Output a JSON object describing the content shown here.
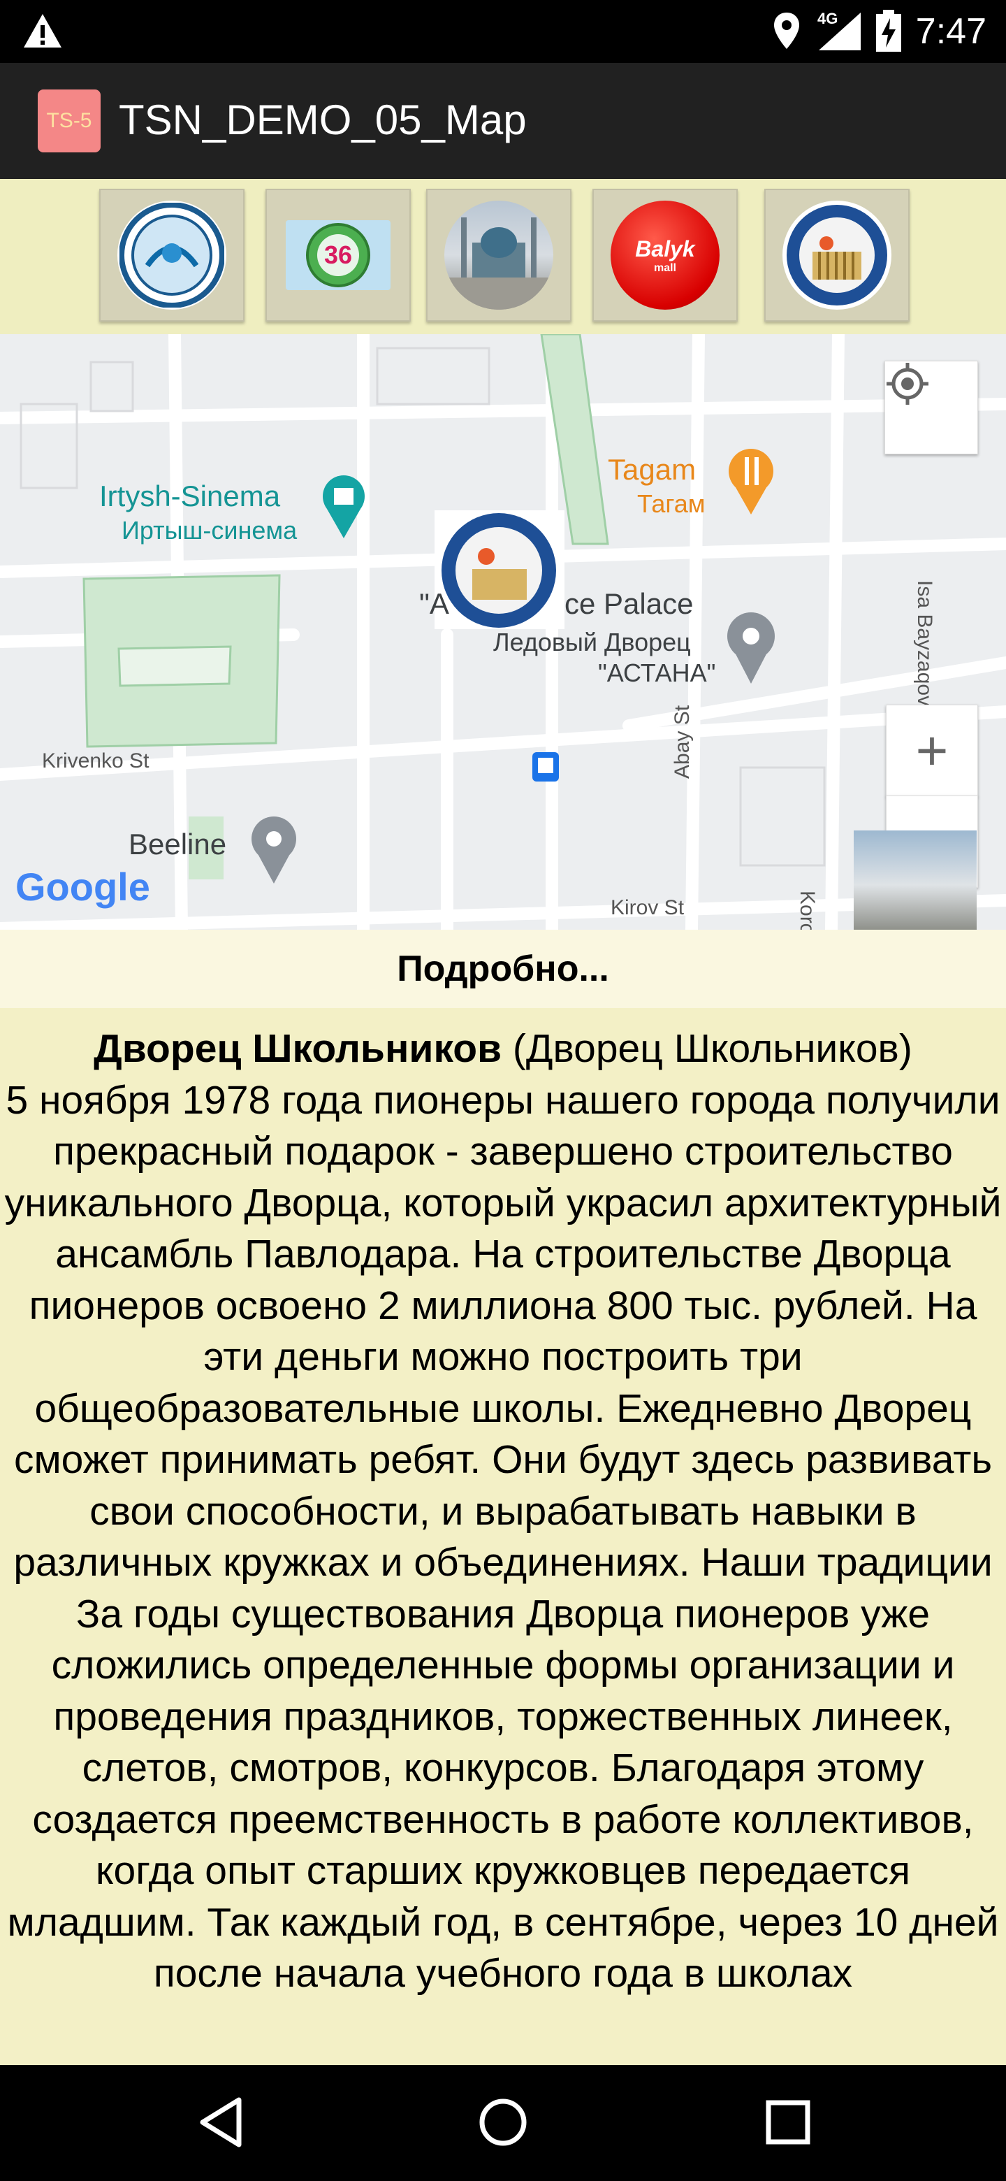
{
  "status_bar": {
    "time": "7:47",
    "network": "4G",
    "icons": [
      "warning-icon",
      "location-icon",
      "signal-icon",
      "battery-icon"
    ]
  },
  "app_bar": {
    "logo_text": "TS-5",
    "title": "TSN_DEMO_05_Map"
  },
  "icon_strip": {
    "items": [
      {
        "name": "emblem-round"
      },
      {
        "name": "emblem-36",
        "text": "36"
      },
      {
        "name": "mosque-photo"
      },
      {
        "name": "balyk-logo",
        "text": "Balyk",
        "subtext": "mall"
      },
      {
        "name": "palace-emblem"
      }
    ]
  },
  "map": {
    "places": {
      "irtysh_en": "Irtysh-Sinema",
      "irtysh_ru": "Иртыш-синема",
      "tagam_en": "Tagam",
      "tagam_ru": "Тагам",
      "palace_en": "\"A",
      "palace_en_rest": "ce Palace",
      "palace_ru_1": "Ледовый Дворец",
      "palace_ru_2": "\"АСТАНА\"",
      "beeline": "Beeline"
    },
    "streets": {
      "krivenko": "Krivenko St",
      "abay": "Abay St",
      "korolenko": "Korolenko Street",
      "kirov": "Kirov St",
      "isa": "Isa Bayzaqov"
    },
    "zoom_in": "+",
    "zoom_out": "−",
    "brand": "Google"
  },
  "details": {
    "header": "Подробно..."
  },
  "description": {
    "title": "Дворец Школьников",
    "subtitle": "(Дворец Школьников)",
    "body": "5 ноября 1978 года пионеры нашего города получили прекрасный подарок - завершено строительство уникального Дворца, который украсил архитектурный ансамбль Павлодара. На строительстве Дворца пионеров освоено 2 миллиона 800 тыс. рублей. На эти деньги можно построить три общеобразовательные школы. Ежедневно Дворец сможет принимать ребят. Они будут здесь развивать свои способности, и вырабатывать навыки в различных кружках и объединениях. Наши традиции За годы существования Дворца пионеров уже сложились определенные формы организации и проведения праздников, торжественных линеек, слетов, смотров, конкурсов. Благодаря этому создается преемственность в работе коллективов, когда опыт старших кружковцев передается младшим. Так каждый год, в сентябре, через 10 дней после начала учебного года в школах"
  },
  "colors": {
    "app_bar": "#212121",
    "strip_bg": "#efeec0",
    "description_bg": "#f3f0c6",
    "details_header_bg": "#faf7e0"
  }
}
